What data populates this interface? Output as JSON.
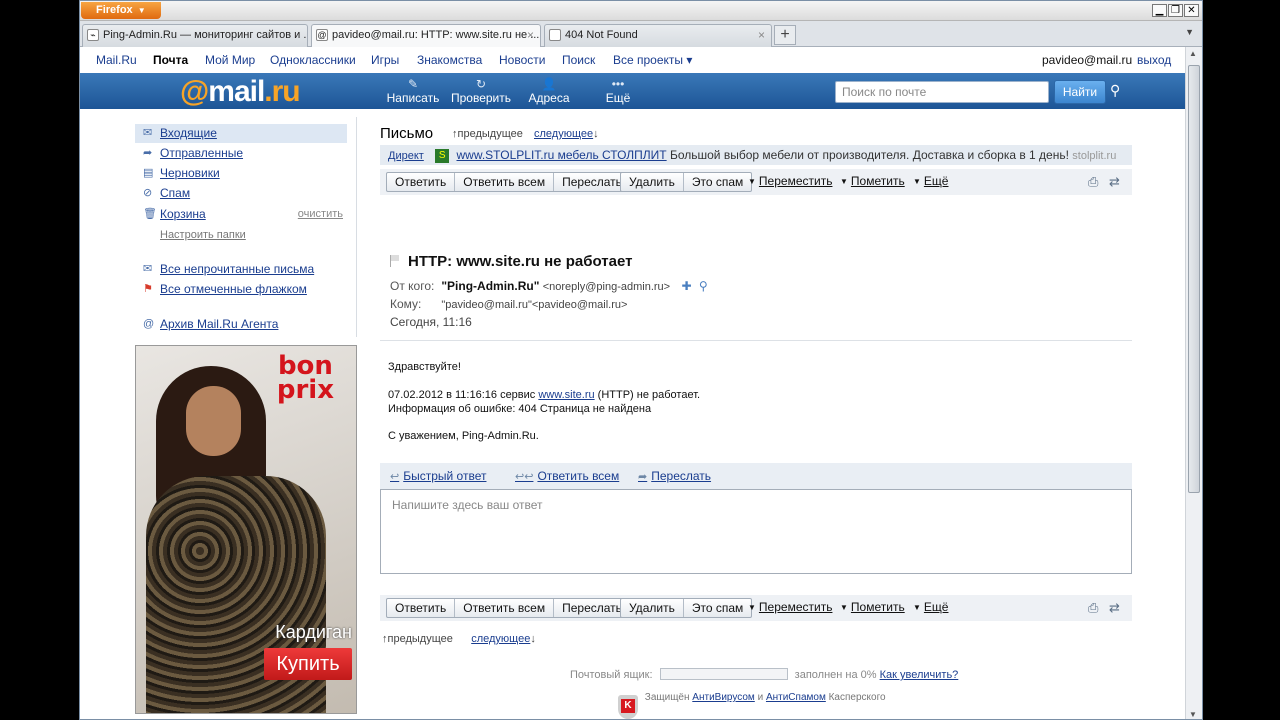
{
  "browser": {
    "menu_label": "Firefox",
    "tabs": [
      {
        "title": "Ping-Admin.Ru — мониторинг сайтов и ...",
        "close": "×"
      },
      {
        "title": "pavideo@mail.ru: HTTP: www.site.ru не ...",
        "close": "×"
      },
      {
        "title": "404 Not Found",
        "close": "×"
      }
    ],
    "new_tab": "+",
    "window_controls": {
      "minimize": "▁",
      "restore": "❐",
      "close": "✕"
    }
  },
  "portal": {
    "links": [
      "Mail.Ru",
      "Почта",
      "Мой Мир",
      "Одноклассники",
      "Игры",
      "Знакомства",
      "Новости",
      "Поиск",
      "Все проекты ▾"
    ],
    "user": "pavideo@mail.ru",
    "logout": "выход"
  },
  "header": {
    "logo_at": "@",
    "logo_mail": "mail",
    "logo_ru": ".ru",
    "buttons": [
      {
        "icon": "✎",
        "label": "Написать"
      },
      {
        "icon": "↻",
        "label": "Проверить"
      },
      {
        "icon": "👤",
        "label": "Адреса"
      },
      {
        "icon": "•••",
        "label": "Ещё"
      }
    ],
    "search_placeholder": "Поиск по почте",
    "search_button": "Найти",
    "advanced_icon": "⚲"
  },
  "sidebar": {
    "folders": [
      {
        "icon": "✉",
        "label": "Входящие"
      },
      {
        "icon": "➦",
        "label": "Отправленные"
      },
      {
        "icon": "▤",
        "label": "Черновики"
      },
      {
        "icon": "⊘",
        "label": "Спам"
      },
      {
        "icon": "🗑",
        "label": "Корзина"
      }
    ],
    "clean": "очистить",
    "configure": "Настроить папки",
    "filters": [
      {
        "icon": "✉",
        "label": "Все непрочитанные письма"
      },
      {
        "icon": "⚑",
        "label": "Все отмеченные флажком"
      }
    ],
    "agent_archive": "Архив Mail.Ru Агента",
    "ad": {
      "brand_line1": "bon",
      "brand_line2": "prix",
      "caption": "Кардиган",
      "cta": "Купить"
    }
  },
  "letter": {
    "heading": "Письмо",
    "prev": "предыдущее",
    "next": "следующее",
    "direct": {
      "label": "Директ",
      "link": "www.STOLPLIT.ru мебель СТОЛПЛИТ",
      "text": "Большой выбор мебели от производителя. Доставка и сборка в 1 день!",
      "site": "stolplit.ru"
    },
    "toolbar": {
      "reply": "Ответить",
      "reply_all": "Ответить всем",
      "forward": "Переслать",
      "delete": "Удалить",
      "spam": "Это спам",
      "move": "Переместить",
      "mark": "Пометить",
      "more": "Ещё"
    },
    "subject": "HTTP: www.site.ru не работает",
    "from_label": "От кого:",
    "from_name": "\"Ping-Admin.Ru\"",
    "from_addr": "<noreply@ping-admin.ru>",
    "to_label": "Кому:",
    "to_value": "\"pavideo@mail.ru\"<pavideo@mail.ru>",
    "date": "Сегодня, 11:16",
    "body": {
      "greeting": "Здравствуйте!",
      "line1_pre": "07.02.2012 в 11:16:16 сервис ",
      "line1_link": "www.site.ru",
      "line1_post": " (HTTP) не работает.",
      "line2": "Информация об ошибке: 404 Страница не найдена",
      "sign": "С уважением, Ping-Admin.Ru."
    },
    "quick": {
      "quick_reply": "Быстрый ответ",
      "reply_all": "Ответить всем",
      "forward": "Переслать"
    },
    "reply_placeholder": "Напишите здесь ваш ответ"
  },
  "footer": {
    "quota_label": "Почтовый ящик:",
    "quota_used_percent": 0,
    "quota_text": "заполнен на 0%",
    "quota_link": "Как увеличить?",
    "protected": "Защищён",
    "antivirus": "АнтиВирусом",
    "and": "и",
    "antispam": "АнтиСпамом",
    "kaspersky": "Касперского"
  }
}
